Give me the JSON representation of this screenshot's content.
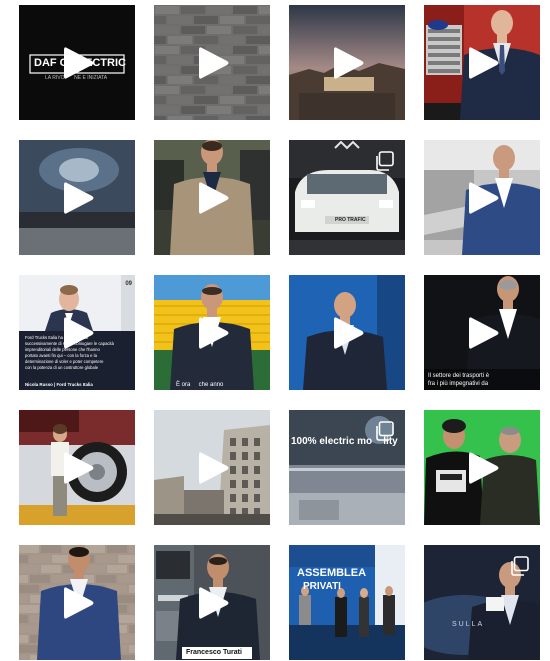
{
  "grid": {
    "tiles": [
      {
        "name": "daf-electric",
        "type": "video",
        "title": "DAF GA",
        "title2": "ECTRIC",
        "subtitle": "LA RIVO       NE E INIZIATA"
      },
      {
        "name": "brick-wall",
        "type": "video"
      },
      {
        "name": "city-skyline",
        "type": "video"
      },
      {
        "name": "man-red-truck",
        "type": "video"
      },
      {
        "name": "stage-screen",
        "type": "video"
      },
      {
        "name": "man-beige-jacket",
        "type": "video"
      },
      {
        "name": "white-electric-van",
        "type": "carousel",
        "label": "PRO TRAFIC"
      },
      {
        "name": "man-blue-suit-show",
        "type": "video"
      },
      {
        "name": "nicola-russo-quote",
        "type": "video",
        "caption": "Ford Trucks Italia ha scelto con lui\nsuccessivamente di saper coniugare le capacità\nimprenditoriali delle persone che l'hanno\nportato avanti fin qui – con la forza e la\ndeterminazione di voler e poter competere\ncon la potenza di un costruttore globale",
        "signature": "Nicola Russo | Ford Trucks Italia",
        "badge": "09"
      },
      {
        "name": "man-stadium",
        "type": "video",
        "caption": "È ora     che anno"
      },
      {
        "name": "man-blue-backdrop",
        "type": "video"
      },
      {
        "name": "man-dark-studio",
        "type": "video",
        "caption": "Il settore dei trasporti è\nfra i più impegnativi da"
      },
      {
        "name": "woman-tire",
        "type": "video"
      },
      {
        "name": "old-town-street",
        "type": "video"
      },
      {
        "name": "electric-mobility",
        "type": "carousel",
        "label": "100% electric mo    lity"
      },
      {
        "name": "two-men-green",
        "type": "video"
      },
      {
        "name": "man-brick-wall",
        "type": "video"
      },
      {
        "name": "francesco-turati",
        "type": "video",
        "nameplate": "Francesco Turati"
      },
      {
        "name": "assemblea-privati",
        "type": "photo",
        "heading1": "ASSEMBLEA",
        "heading2": "PRIVATI"
      },
      {
        "name": "man-stage-presenter",
        "type": "carousel",
        "label": "SULLA"
      }
    ]
  }
}
